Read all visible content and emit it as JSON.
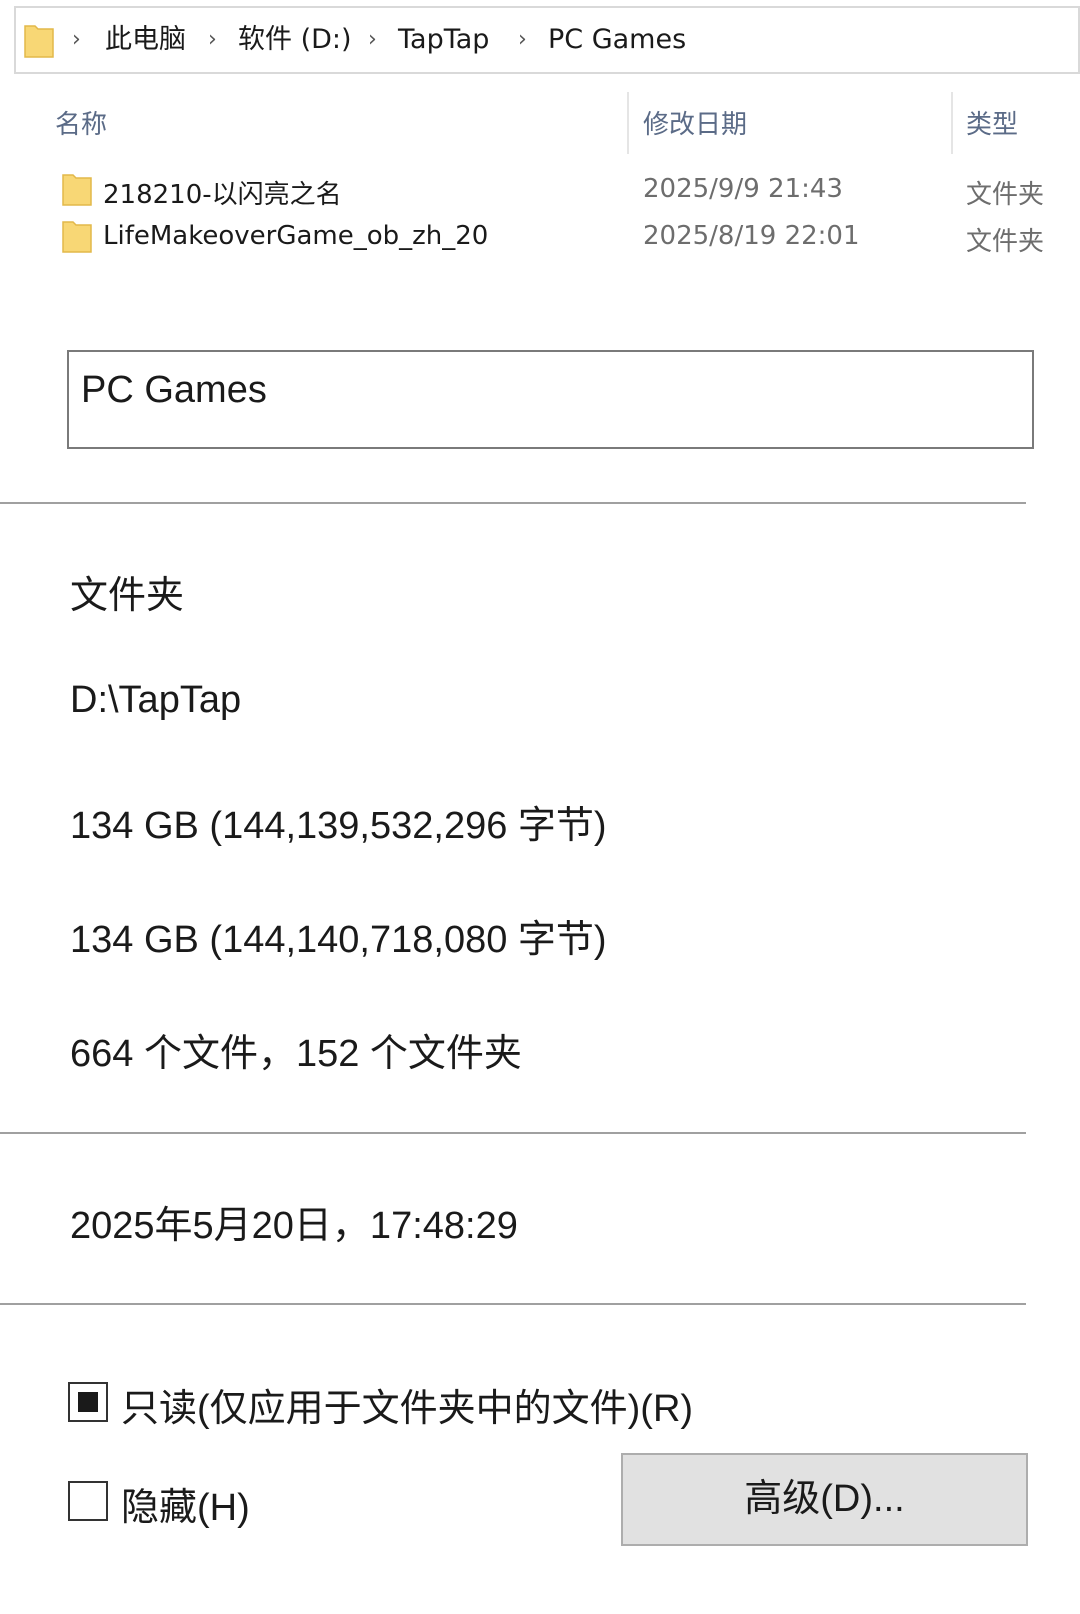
{
  "breadcrumb": {
    "items": [
      "此电脑",
      "软件 (D:)",
      "TapTap",
      "PC Games"
    ],
    "separator": "›",
    "root_icon": "folder-icon"
  },
  "file_list": {
    "columns": [
      "名称",
      "修改日期",
      "类型"
    ],
    "rows": [
      {
        "name": "218210-以闪亮之名",
        "date": "2025/9/9 21:43",
        "type": "文件夹",
        "icon": "folder-icon"
      },
      {
        "name": "LifeMakeoverGame_ob_zh_20",
        "date": "2025/8/19 22:01",
        "type": "文件夹",
        "icon": "folder-icon"
      }
    ]
  },
  "properties": {
    "folder_name": "PC Games",
    "type": "文件夹",
    "location": "D:\\TapTap",
    "size": "134 GB (144,139,532,296 字节)",
    "size_on_disk": "134 GB (144,140,718,080 字节)",
    "contains": "664 个文件，152 个文件夹",
    "created": "2025年5月20日，17:48:29"
  },
  "attributes": {
    "readonly_label": "只读(仅应用于文件夹中的文件)(R)",
    "readonly_state": "indeterminate",
    "hidden_label": "隐藏(H)",
    "hidden_checked": false,
    "advanced_button": "高级(D)..."
  },
  "colors": {
    "folder": "#f8d775",
    "header_text": "#5b6b87",
    "button_bg": "#e1e1e1"
  }
}
